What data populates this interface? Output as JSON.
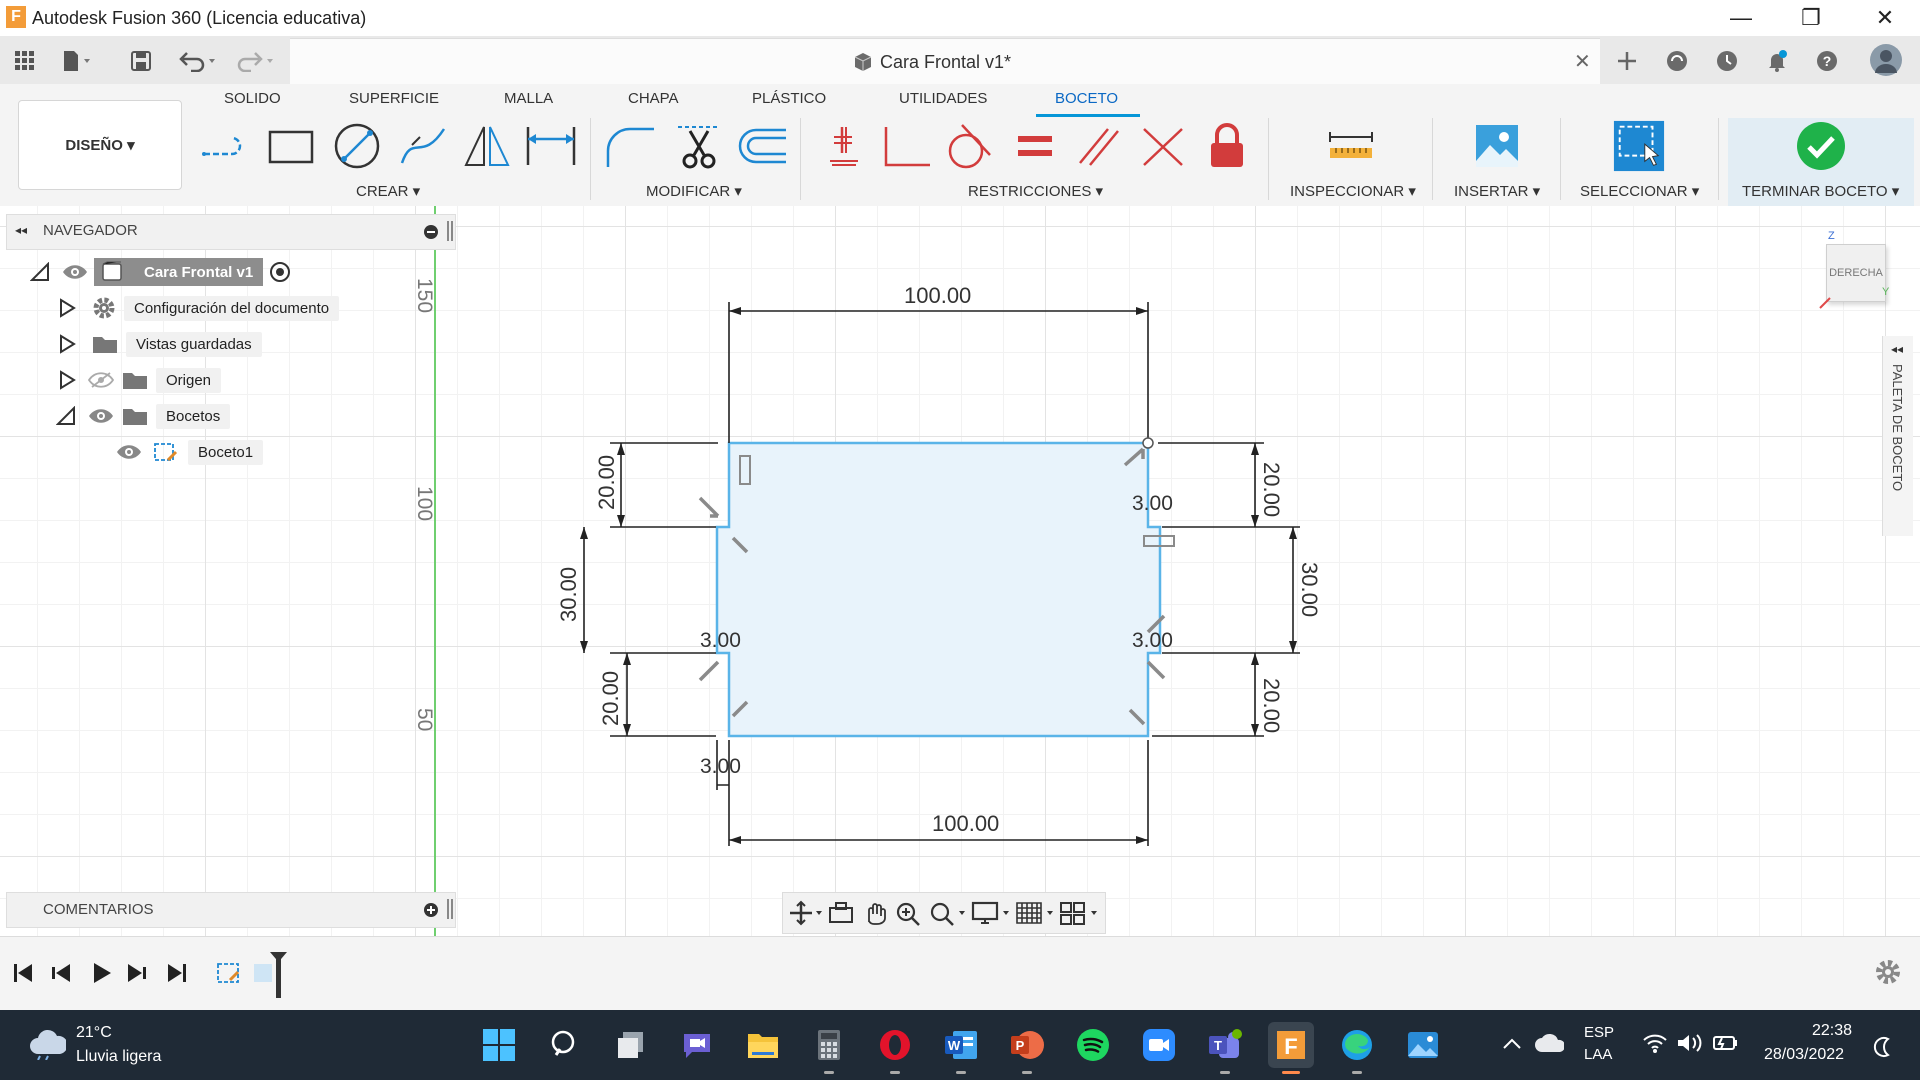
{
  "window": {
    "title": "Autodesk Fusion 360 (Licencia educativa)",
    "minimize": "—",
    "maximize": "❐",
    "close": "✕"
  },
  "doc_tab": {
    "title": "Cara Frontal v1*",
    "close": "✕"
  },
  "workspace": {
    "label": "DISEÑO ▾"
  },
  "ribbon_tabs": [
    {
      "label": "SOLIDO"
    },
    {
      "label": "SUPERFICIE"
    },
    {
      "label": "MALLA"
    },
    {
      "label": "CHAPA"
    },
    {
      "label": "PLÁSTICO"
    },
    {
      "label": "UTILIDADES"
    },
    {
      "label": "BOCETO"
    }
  ],
  "ribbon_groups": {
    "crear": "CREAR ▾",
    "modificar": "MODIFICAR ▾",
    "restricciones": "RESTRICCIONES ▾",
    "inspeccionar": "INSPECCIONAR ▾",
    "insertar": "INSERTAR ▾",
    "seleccionar": "SELECCIONAR ▾",
    "terminar": "TERMINAR BOCETO ▾"
  },
  "navigator": {
    "title": "NAVEGADOR",
    "root": "Cara Frontal v1",
    "items": [
      {
        "label": "Configuración del documento"
      },
      {
        "label": "Vistas guardadas"
      },
      {
        "label": "Origen"
      },
      {
        "label": "Bocetos"
      },
      {
        "label": "Boceto1"
      }
    ]
  },
  "comments": {
    "label": "COMENTARIOS"
  },
  "ruler": {
    "t150": "150",
    "t100": "100",
    "t50": "50"
  },
  "view_cube": {
    "face": "DERECHA",
    "z": "Z",
    "y": "Y"
  },
  "sketch_palette": {
    "label": "PALETA DE BOCETO"
  },
  "dimensions": {
    "top_width": "100.00",
    "bottom_width": "100.00",
    "left_upper": "20.00",
    "left_mid": "30.00",
    "left_lower": "20.00",
    "right_upper": "20.00",
    "right_mid": "30.00",
    "right_lower": "20.00",
    "notch_tr": "3.00",
    "notch_bl": "3.00",
    "notch_br": "3.00",
    "notch_bottom": "3.00"
  },
  "taskbar": {
    "weather_temp": "21°C",
    "weather_desc": "Lluvia ligera",
    "lang1": "ESP",
    "lang2": "LAA",
    "time": "22:38",
    "date": "28/03/2022"
  },
  "colors": {
    "accent": "#0696d7",
    "sketch_fill": "#e8f3fb",
    "sketch_line": "#5ab4e8",
    "finish_green": "#1fb24a"
  }
}
